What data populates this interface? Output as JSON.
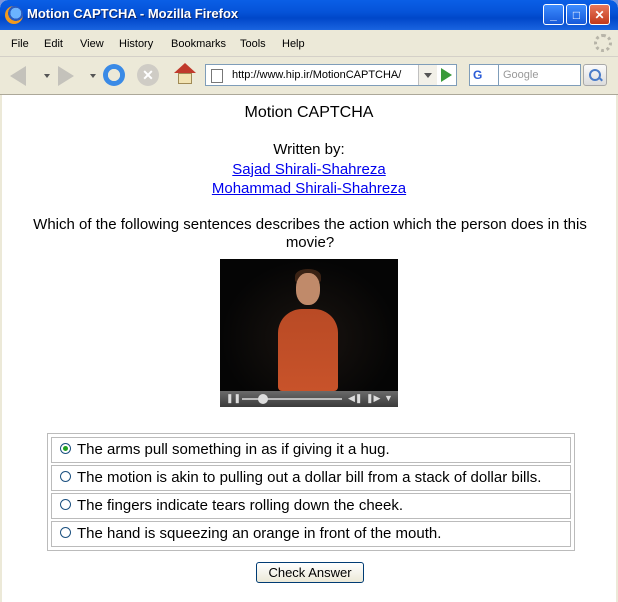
{
  "window": {
    "title": "Motion CAPTCHA - Mozilla Firefox"
  },
  "menu": [
    "File",
    "Edit",
    "View",
    "History",
    "Bookmarks",
    "Tools",
    "Help"
  ],
  "nav": {
    "url": "http://www.hip.ir/MotionCAPTCHA/",
    "search_placeholder": "Google",
    "search_engine_icon": "G"
  },
  "page": {
    "title": "Motion CAPTCHA",
    "written_by": "Written by:",
    "authors": [
      "Sajad Shirali-Shahreza",
      "Mohammad Shirali-Shahreza"
    ],
    "question": "Which of the following sentences describes the action which the person does in this movie?",
    "options": [
      {
        "label": "The arms pull something in as if giving it a hug.",
        "selected": true
      },
      {
        "label": "The motion is akin to pulling out a dollar bill from a stack of dollar bills.",
        "selected": false
      },
      {
        "label": "The fingers indicate tears rolling down the cheek.",
        "selected": false
      },
      {
        "label": "The hand is squeezing an orange in front of the mouth.",
        "selected": false
      }
    ],
    "submit_label": "Check Answer"
  },
  "colors": {
    "titlebar": "#0553d8",
    "link": "#0000ee",
    "radio_checked": "#21a121"
  }
}
